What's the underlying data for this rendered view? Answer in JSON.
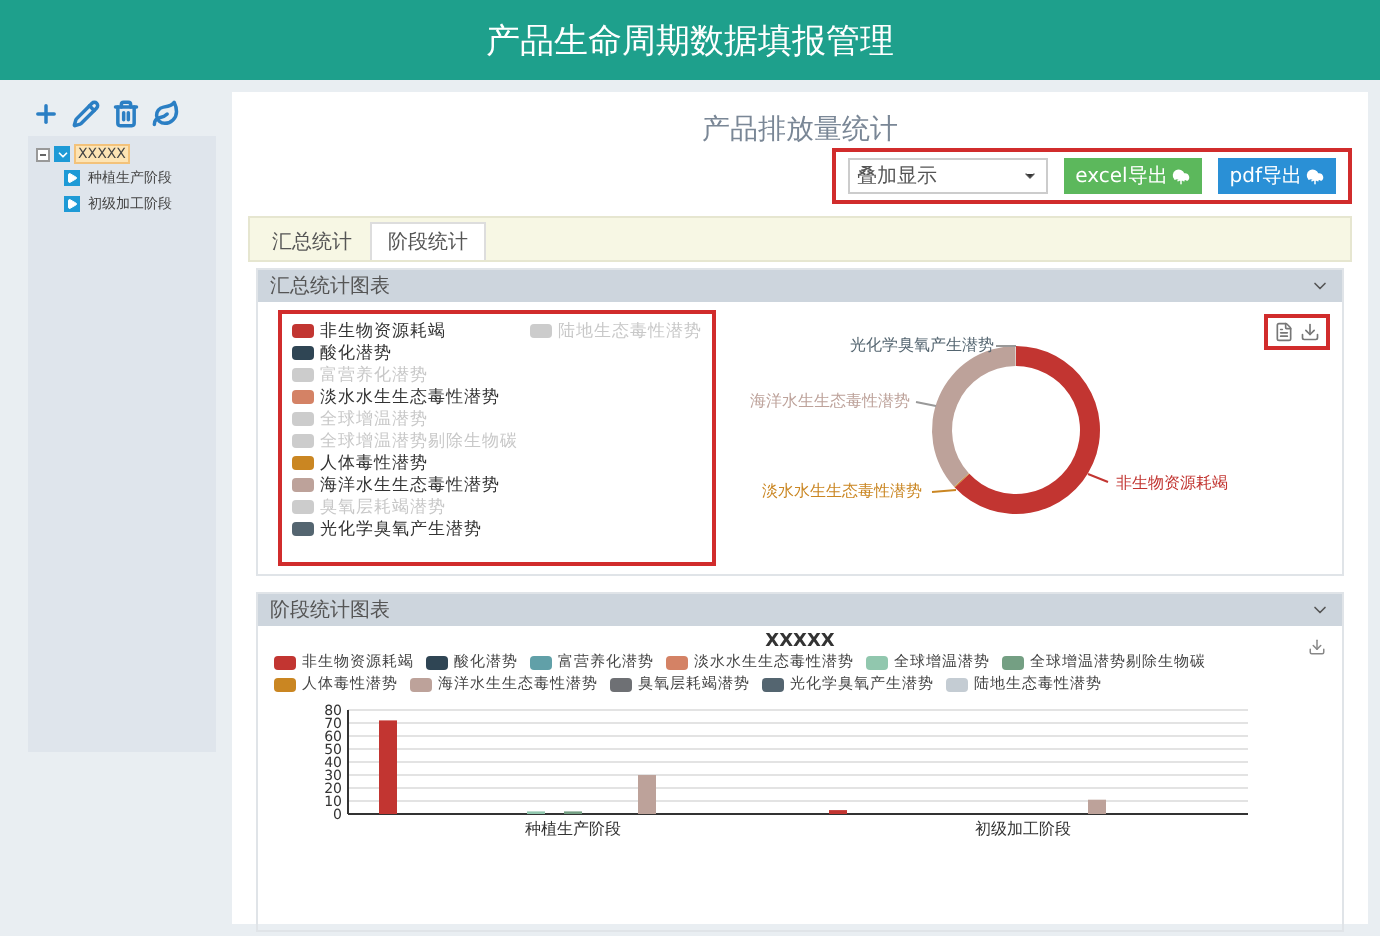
{
  "header": {
    "title": "产品生命周期数据填报管理"
  },
  "sidebar": {
    "tools": [
      {
        "kind": "add"
      },
      {
        "kind": "edit"
      },
      {
        "kind": "delete"
      },
      {
        "kind": "leaf"
      }
    ],
    "tree": [
      {
        "label": "XXXXX",
        "selected": true,
        "expanded": true,
        "children": [
          {
            "label": "种植生产阶段",
            "selected": false
          },
          {
            "label": "初级加工阶段",
            "selected": false
          }
        ]
      }
    ]
  },
  "page": {
    "title": "产品排放量统计"
  },
  "toolbar": {
    "annotated": true,
    "select": {
      "value": "叠加显示"
    },
    "buttons": [
      {
        "label": "excel导出",
        "kind": "excel"
      },
      {
        "label": "pdf导出",
        "kind": "pdf"
      }
    ]
  },
  "tabs": [
    {
      "label": "汇总统计",
      "selected": false
    },
    {
      "label": "阶段统计",
      "selected": true
    }
  ],
  "summary_panel": {
    "title": "汇总统计图表",
    "legend_annotated": true,
    "tools_annotated": true,
    "legend": [
      {
        "label": "非生物资源耗竭",
        "color": "#c23531",
        "disabled": false
      },
      {
        "label": "酸化潜势",
        "color": "#2f4554",
        "disabled": false
      },
      {
        "label": "富营养化潜势",
        "disabled": true
      },
      {
        "label": "淡水水生生态毒性潜势",
        "color": "#d48265",
        "disabled": false
      },
      {
        "label": "全球增温潜势",
        "disabled": true
      },
      {
        "label": "全球增温潜势剔除生物碳",
        "disabled": true
      },
      {
        "label": "人体毒性潜势",
        "color": "#ca8622",
        "disabled": false
      },
      {
        "label": "海洋水生生态毒性潜势",
        "color": "#bda29a",
        "disabled": false
      },
      {
        "label": "臭氧层耗竭潜势",
        "disabled": true
      },
      {
        "label": "光化学臭氧产生潜势",
        "color": "#546570",
        "disabled": false
      },
      {
        "label": "陆地生态毒性潜势",
        "disabled": true
      }
    ],
    "donut_labels": [
      {
        "label": "光化学臭氧产生潜势",
        "color": "#546570"
      },
      {
        "label": "海洋水生生态毒性潜势",
        "color": "#bda29a"
      },
      {
        "label": "淡水水生生态毒性潜势",
        "color": "#ca8622"
      },
      {
        "label": "非生物资源耗竭",
        "color": "#c23531"
      }
    ]
  },
  "stage_panel": {
    "title": "阶段统计图表",
    "chart_data": {
      "type": "bar",
      "title": "XXXXX",
      "grid": true,
      "categories": [
        "种植生产阶段",
        "初级加工阶段"
      ],
      "ylim": [
        0,
        80
      ],
      "yticks": [
        0,
        10,
        20,
        30,
        40,
        50,
        60,
        70,
        80
      ],
      "series": [
        {
          "name": "非生物资源耗竭",
          "color": "#c23531",
          "values": [
            72,
            3
          ]
        },
        {
          "name": "酸化潜势",
          "color": "#2f4554",
          "values": [
            0,
            0
          ]
        },
        {
          "name": "富营养化潜势",
          "color": "#61a0a8",
          "values": [
            0,
            0
          ]
        },
        {
          "name": "淡水水生生态毒性潜势",
          "color": "#d48265",
          "values": [
            0,
            0
          ]
        },
        {
          "name": "全球增温潜势",
          "color": "#91c7ae",
          "values": [
            2,
            0
          ]
        },
        {
          "name": "全球增温潜势剔除生物碳",
          "color": "#749f83",
          "values": [
            2,
            0
          ]
        },
        {
          "name": "人体毒性潜势",
          "color": "#ca8622",
          "values": [
            0,
            0
          ]
        },
        {
          "name": "海洋水生生态毒性潜势",
          "color": "#bda29a",
          "values": [
            30,
            11
          ]
        },
        {
          "name": "臭氧层耗竭潜势",
          "color": "#6e7074",
          "values": [
            0,
            0
          ]
        },
        {
          "name": "光化学臭氧产生潜势",
          "color": "#546570",
          "values": [
            0,
            0
          ]
        },
        {
          "name": "陆地生态毒性潜势",
          "color": "#c4ccd3",
          "values": [
            0,
            0
          ]
        }
      ]
    }
  }
}
